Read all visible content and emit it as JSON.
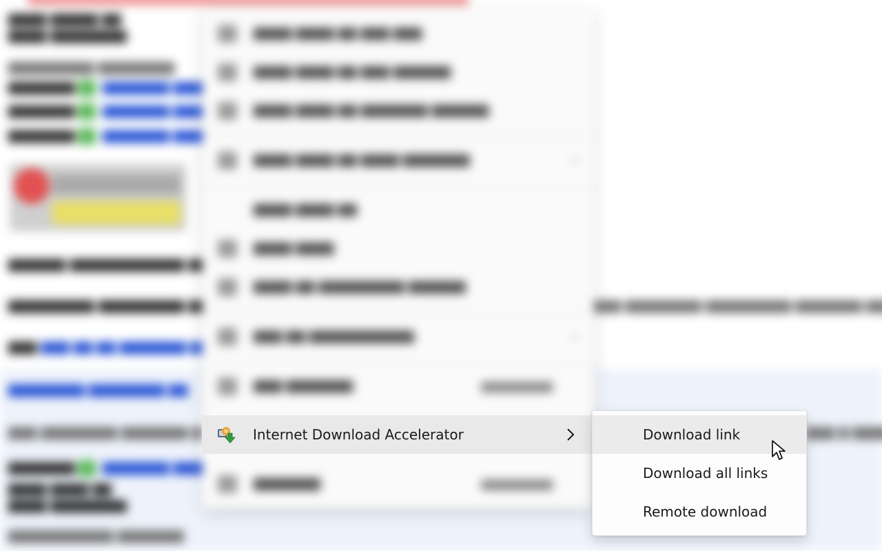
{
  "context_menu": {
    "highlighted_item": {
      "label": "Internet Download Accelerator",
      "icon": "internet-download-accelerator-icon"
    }
  },
  "submenu": {
    "items": [
      {
        "label": "Download link",
        "hovered": true
      },
      {
        "label": "Download all links",
        "hovered": false
      },
      {
        "label": "Remote download",
        "hovered": false
      }
    ]
  },
  "colors": {
    "highlight": "#e9e9e9",
    "submenu_bg": "#fdfdfd",
    "hover": "#ebebeb",
    "text": "#1a1a1a"
  }
}
